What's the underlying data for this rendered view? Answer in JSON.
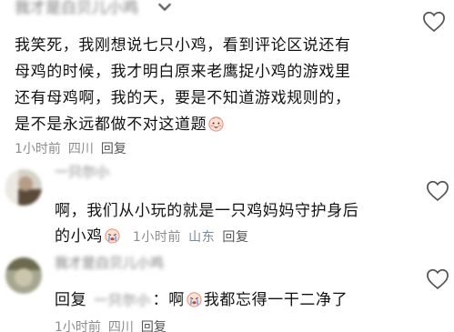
{
  "comment1": {
    "author": "我才是白贝儿小鸡",
    "lines": [
      "我笑死，我刚想说七只小鸡，看到评论区说还有",
      "母鸡的时候，我才明白原来老鹰捉小鸡的游戏里",
      "还有母鸡啊，我的天，要是不知道游戏规则的，",
      "是不是永远都做不对这道题"
    ],
    "time": "1小时前",
    "location": "四川",
    "reply": "回复",
    "like_icon": "heart-outline-icon"
  },
  "comment2": {
    "author": "一只尔小",
    "lines": [
      "啊，我们从小玩的就是一只鸡妈妈守护身后",
      "的小鸡"
    ],
    "time": "1小时前",
    "location": "山东",
    "reply": "回复",
    "like_icon": "heart-outline-icon"
  },
  "comment3": {
    "author": "我才是白贝儿小鸡",
    "reply_prefix": "回复",
    "reply_target": "一只尔小",
    "text_before_emoji": "：啊",
    "text_after_emoji": "我都忘得一干二净了",
    "time": "1小时前",
    "location": "四川",
    "reply": "回复",
    "like_icon": "heart-outline-icon"
  },
  "colors": {
    "text": "#111111",
    "meta": "#8c8c8c",
    "location_comment2": "#7a8aa0",
    "background": "#ffffff"
  }
}
